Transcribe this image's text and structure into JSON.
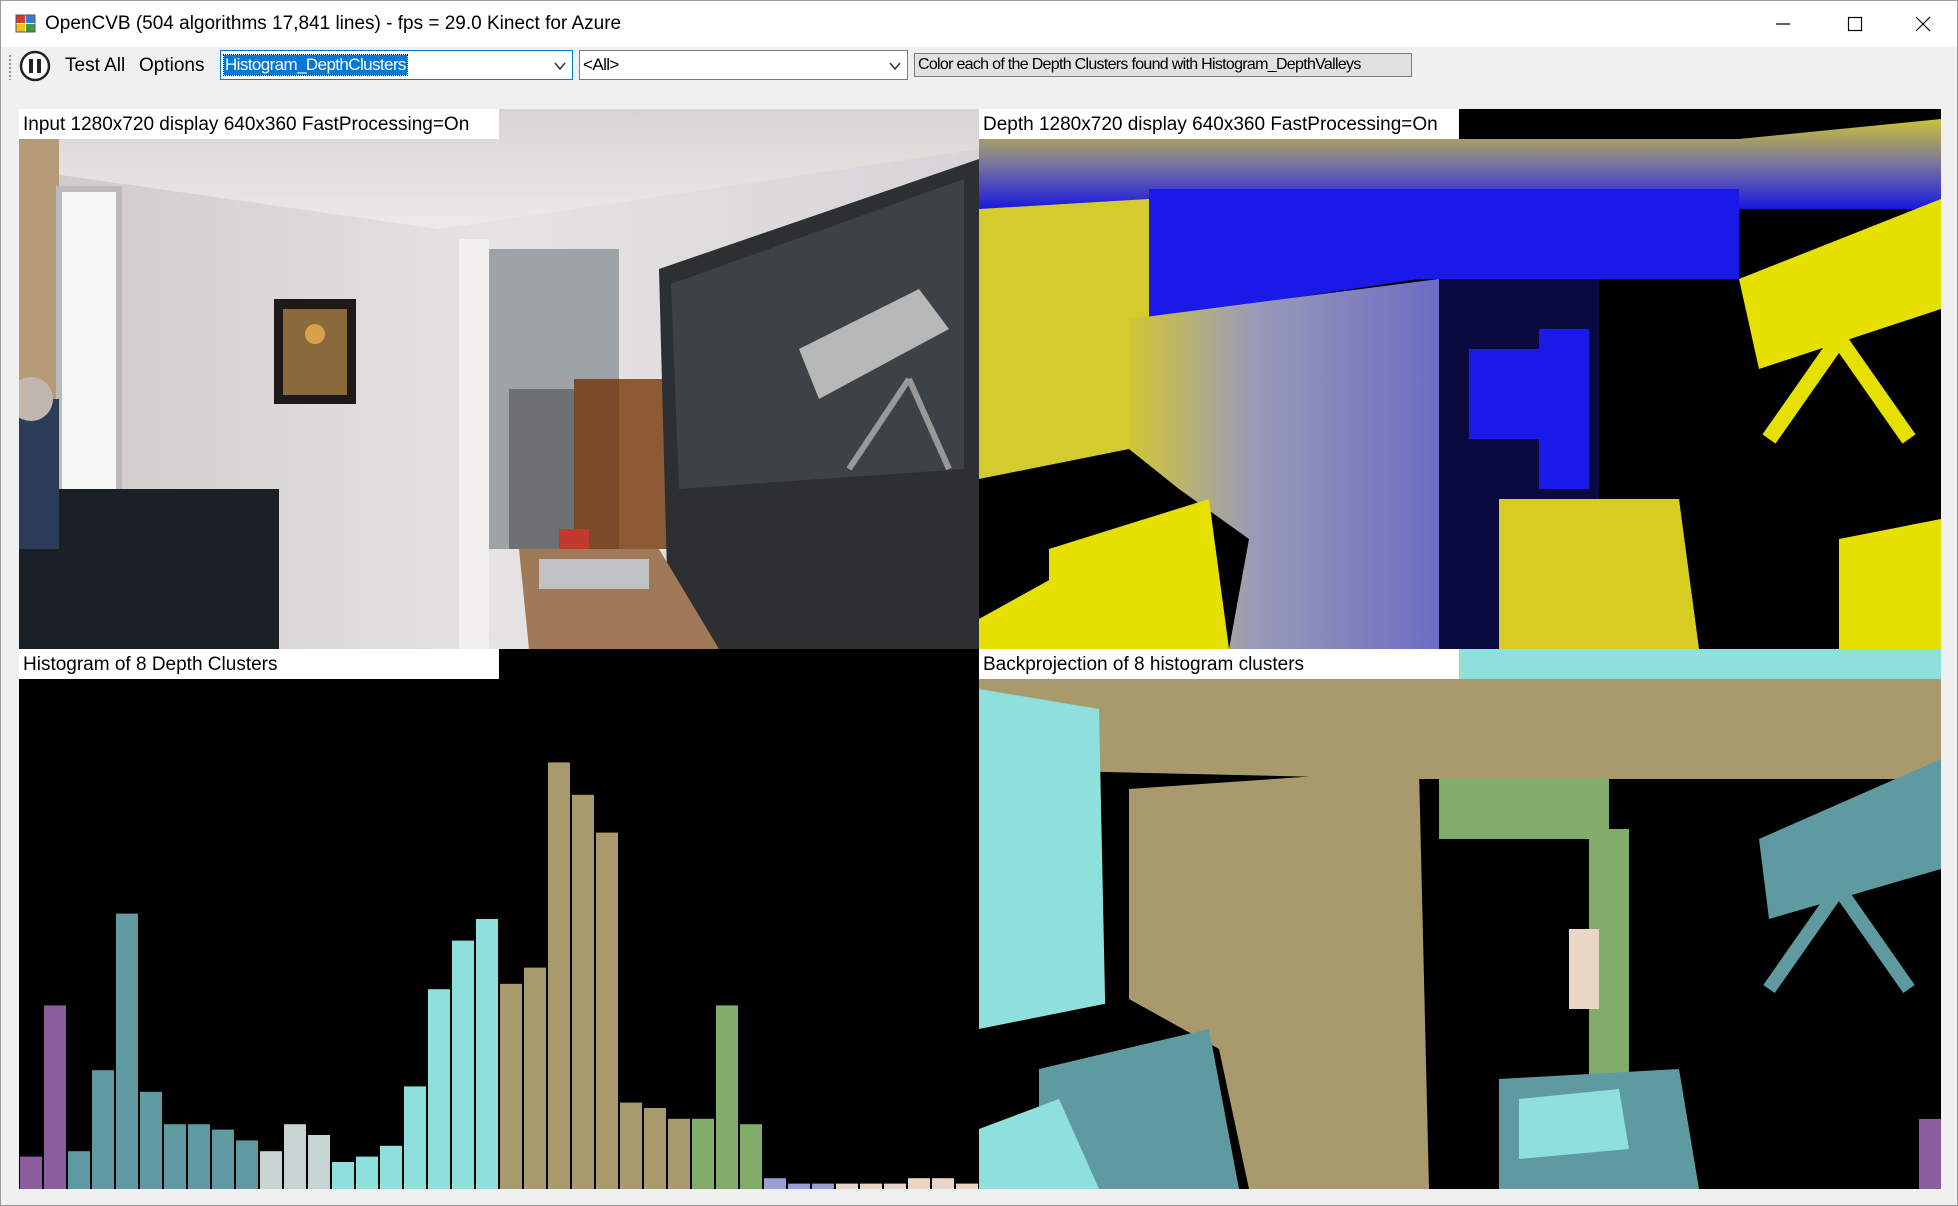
{
  "window": {
    "title": "OpenCVB (504 algorithms 17,841 lines) - fps = 29.0 Kinect for Azure",
    "icon": "opencvb-app-icon",
    "controls": [
      "minimize-icon",
      "maximize-icon",
      "close-icon"
    ]
  },
  "toolbar": {
    "pause_icon": "pause-icon",
    "test_all_label": "Test All",
    "options_label": "Options",
    "algorithm_combo": {
      "value": "Histogram_DepthClusters"
    },
    "group_combo": {
      "value": "<All>"
    },
    "description": "Color each of the Depth Clusters found with Histogram_DepthValleys"
  },
  "panes": {
    "input": {
      "label": "Input  1280x720  display  640x360  FastProcessing=On"
    },
    "depth": {
      "label": "Depth  1280x720  display  640x360  FastProcessing=On"
    },
    "histogram": {
      "label": "Histogram of 8 Depth Clusters"
    },
    "backprojection": {
      "label": "Backprojection of 8 histogram clusters"
    }
  },
  "colors": {
    "cluster_purple": "#8a5e9e",
    "cluster_teal": "#5f9aa1",
    "cluster_silver": "#c8d4d2",
    "cluster_cyan": "#8de0dc",
    "cluster_khaki": "#a89a6c",
    "cluster_green": "#82ac6a",
    "cluster_lavender": "#9c9cd6",
    "cluster_peach": "#e9d6c4"
  },
  "chart_data": {
    "type": "bar",
    "title": "Histogram of 8 Depth Clusters",
    "xlabel": "",
    "ylabel": "",
    "ylim": [
      0,
      100
    ],
    "values": [
      6,
      34,
      7,
      22,
      51,
      18,
      12,
      12,
      11,
      9,
      7,
      12,
      10,
      5,
      6,
      8,
      19,
      37,
      46,
      50,
      38,
      41,
      79,
      73,
      66,
      16,
      15,
      13,
      13,
      34,
      12,
      2,
      1,
      1,
      1,
      1,
      1,
      2,
      2,
      1
    ],
    "bar_colors": [
      "cluster_purple",
      "cluster_purple",
      "cluster_teal",
      "cluster_teal",
      "cluster_teal",
      "cluster_teal",
      "cluster_teal",
      "cluster_teal",
      "cluster_teal",
      "cluster_teal",
      "cluster_silver",
      "cluster_silver",
      "cluster_silver",
      "cluster_cyan",
      "cluster_cyan",
      "cluster_cyan",
      "cluster_cyan",
      "cluster_cyan",
      "cluster_cyan",
      "cluster_cyan",
      "cluster_khaki",
      "cluster_khaki",
      "cluster_khaki",
      "cluster_khaki",
      "cluster_khaki",
      "cluster_khaki",
      "cluster_khaki",
      "cluster_khaki",
      "cluster_green",
      "cluster_green",
      "cluster_green",
      "cluster_lavender",
      "cluster_lavender",
      "cluster_lavender",
      "cluster_peach",
      "cluster_peach",
      "cluster_peach",
      "cluster_peach",
      "cluster_peach",
      "cluster_peach"
    ],
    "grid": false,
    "legend": "none"
  }
}
